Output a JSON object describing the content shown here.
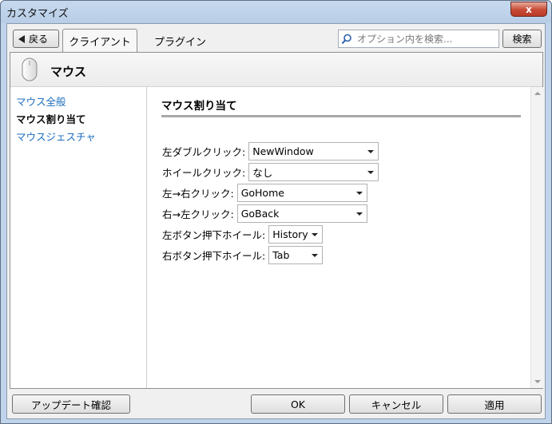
{
  "window": {
    "title": "カスタマイズ",
    "close_glyph": "x"
  },
  "toolbar": {
    "back_label": "戻る",
    "tabs": [
      {
        "label": "クライアント",
        "active": true
      },
      {
        "label": "プラグイン",
        "active": false
      }
    ],
    "search_placeholder": "オプション内を検索...",
    "search_button": "検索"
  },
  "panel": {
    "section_title": "マウス",
    "sidebar": [
      {
        "label": "マウス全般",
        "selected": false
      },
      {
        "label": "マウス割り当て",
        "selected": true
      },
      {
        "label": "マウスジェスチャ",
        "selected": false
      }
    ],
    "content_title": "マウス割り当て",
    "settings": [
      {
        "label": "左ダブルクリック:",
        "value": "NewWindow"
      },
      {
        "label": "ホイールクリック:",
        "value": "なし"
      },
      {
        "label": "左→右クリック:",
        "value": "GoHome"
      },
      {
        "label": "右→左クリック:",
        "value": "GoBack"
      },
      {
        "label": "左ボタン押下ホイール:",
        "value": "History"
      },
      {
        "label": "右ボタン押下ホイール:",
        "value": "Tab"
      }
    ]
  },
  "footer": {
    "update_button": "アップデート確認",
    "ok_button": "OK",
    "cancel_button": "キャンセル",
    "apply_button": "適用"
  },
  "colors": {
    "link": "#1f6fbf",
    "close_button": "#c74a36",
    "frame": "#bfd4ea"
  }
}
